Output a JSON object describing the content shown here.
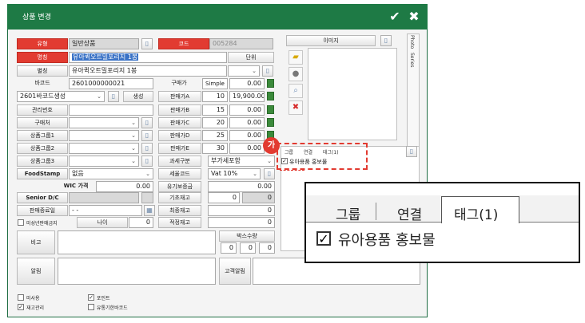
{
  "window": {
    "title": "상품 변경",
    "confirm_icon": "✔",
    "close_icon": "✖"
  },
  "colors": {
    "titlebar": "#1e7a45",
    "required_label": "#e23b31",
    "highlight_badge": "#e23b31"
  },
  "labels": {
    "type": "유형",
    "name": "명칭",
    "alias": "별칭",
    "barcode": "바코드",
    "mgmt_no": "관리번호",
    "vendor": "구매처",
    "group1": "상품그룹1",
    "group2": "상품그룹2",
    "group3": "상품그룹3",
    "foodstamp": "FoodStamp",
    "wic": "WIC 가격",
    "senior": "Senior D/C",
    "sale_end": "판매종료일",
    "minor_ban": "미성년판매금지",
    "age": "나이",
    "note": "비고",
    "alarm": "알림",
    "code": "코드",
    "unit": "단위",
    "purchase_price": "구매가",
    "price_a": "판매가A",
    "price_b": "판매가B",
    "price_c": "판매가C",
    "price_d": "판매가D",
    "price_e": "판매가E",
    "tax": "과세구분",
    "tax_code": "세율코드",
    "wholesale": "유기보증금",
    "base_stock": "기초재고",
    "final_stock": "최종재고",
    "proper_stock": "적정재고",
    "box_qty": "박스수량",
    "customer_alarm": "고객알림",
    "unused": "미사용",
    "stock_mgmt": "재고관리",
    "point": "포인트",
    "expire_barcode": "유통기한바코드",
    "image": "이미지",
    "create": "생성"
  },
  "values": {
    "type": "일반상품",
    "code": "005284",
    "name": "유아퀵오트밀포리지 1봉",
    "alias": "유아퀵오트밀포리지 1봉",
    "barcode": "2601000000021",
    "barcode_type": "2601바코드생성",
    "purchase_mode": "Simple",
    "purchase_price": "0.00",
    "price_a_qty": "10",
    "price_a": "19,900.00",
    "price_b_qty": "15",
    "price_b": "0.00",
    "price_c_qty": "20",
    "price_c": "0.00",
    "price_d_qty": "25",
    "price_d": "0.00",
    "price_e_qty": "30",
    "price_e": "0.00",
    "tax": "부가세포함",
    "tax_code": "Vat 10%",
    "wholesale": "0.00",
    "foodstamp": "없음",
    "wic": "0.00",
    "sale_end": "- -",
    "age": "0",
    "base_stock_a": "0",
    "base_stock_b": "0",
    "final_stock": "0",
    "proper_stock": "0",
    "box_a": "0",
    "box_b": "0",
    "box_c": "0"
  },
  "tabs": {
    "side1": "Photo",
    "side2": "Series",
    "group": "그룹",
    "link": "연결",
    "tag": "태그(1)"
  },
  "tag_item": "유아용품 홍보물",
  "badge": "가",
  "zoom": {
    "group": "그룹",
    "link": "연결",
    "tag": "태그(1)",
    "tag_item": "유아용품 홍보물"
  }
}
